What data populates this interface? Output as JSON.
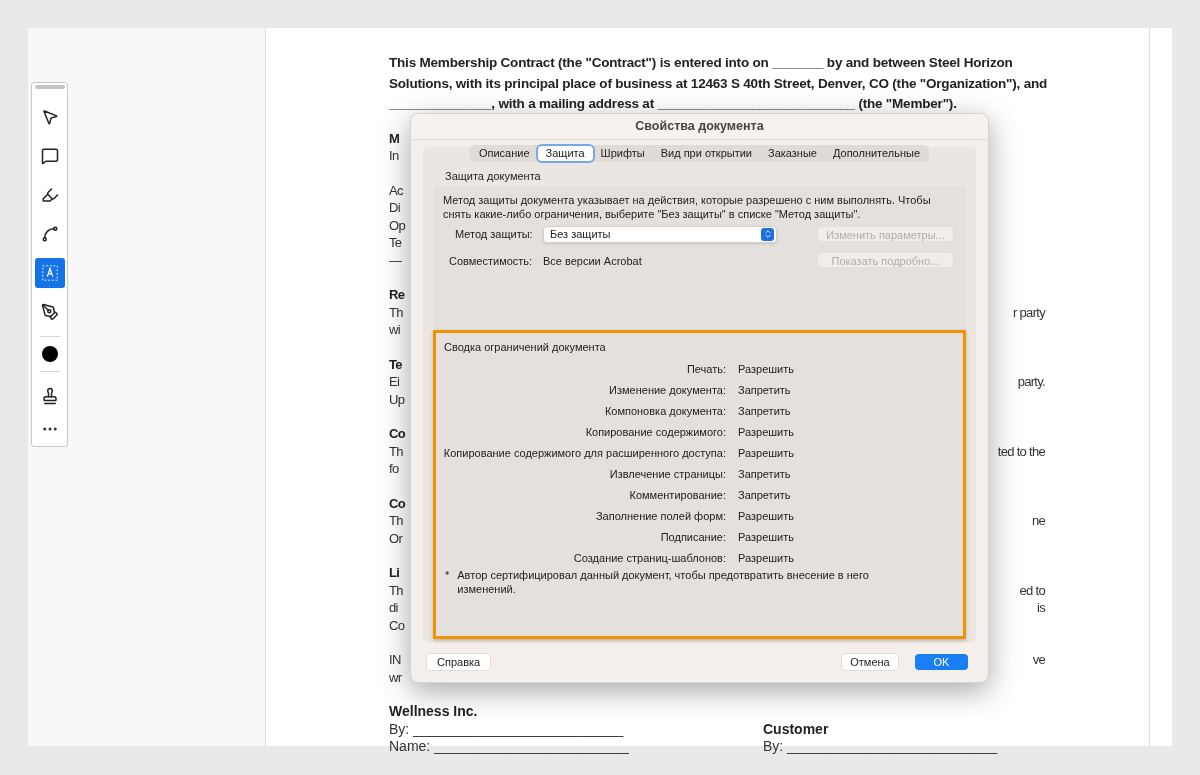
{
  "toolbar": {
    "tools": [
      {
        "kind": "pointer",
        "selected": false
      },
      {
        "kind": "comment",
        "selected": false
      },
      {
        "kind": "highlight",
        "selected": false
      },
      {
        "kind": "draw",
        "selected": false
      },
      {
        "kind": "text-box",
        "selected": true
      },
      {
        "kind": "sign",
        "selected": false
      },
      {
        "kind": "separator"
      },
      {
        "kind": "color",
        "color": "#000000"
      },
      {
        "kind": "separator"
      },
      {
        "kind": "stamp",
        "selected": false
      },
      {
        "kind": "more"
      }
    ]
  },
  "document": {
    "intro": "This Membership Contract (the \"Contract\") is entered into on _______ by and between Steel Horizon Solutions, with its principal place of business at 12463 S 40th Street, Denver, CO (the \"Organization\"), and ______________, with a mailing address at ___________________________ (the \"Member\").",
    "sections": [
      {
        "heading": "M",
        "lines": [
          {
            "left": "In"
          }
        ]
      },
      {
        "lines": [
          {
            "left": "Ac"
          },
          {
            "left": "Di"
          },
          {
            "left": "Op"
          },
          {
            "left": "Te"
          },
          {
            "left": "—"
          }
        ]
      },
      {
        "heading": "Re",
        "lines": [
          {
            "left": "Th",
            "right": "r party"
          },
          {
            "left": "wi"
          }
        ]
      },
      {
        "heading": "Te",
        "lines": [
          {
            "left": "Ei",
            "right": "party."
          },
          {
            "left": "Up"
          }
        ]
      },
      {
        "heading": "Co",
        "lines": [
          {
            "left": "Th",
            "right": "ted to the"
          },
          {
            "left": "fo"
          }
        ]
      },
      {
        "heading": "Co",
        "lines": [
          {
            "left": "Th",
            "right": "ne"
          },
          {
            "left": "Or"
          }
        ]
      },
      {
        "heading": "Li",
        "lines": [
          {
            "left": "Th",
            "right": "ed to"
          },
          {
            "left": "di",
            "right": "is"
          },
          {
            "left": "Co"
          }
        ]
      },
      {
        "lines": [
          {
            "left": "IN",
            "right": "ve"
          },
          {
            "left": "wr"
          }
        ]
      }
    ],
    "signatures": [
      {
        "party": "Wellness Inc.",
        "lines": [
          "By: ___________________________",
          "Name: _________________________"
        ]
      },
      {
        "party": "Customer",
        "lines": [
          "By: ___________________________"
        ]
      }
    ]
  },
  "dialog": {
    "title": "Свойства документа",
    "tabs": [
      {
        "label": "Описание",
        "selected": false
      },
      {
        "label": "Защита",
        "selected": true
      },
      {
        "label": "Шрифты",
        "selected": false
      },
      {
        "label": "Вид при открытии",
        "selected": false
      },
      {
        "label": "Заказные",
        "selected": false
      },
      {
        "label": "Дополнительные",
        "selected": false
      }
    ],
    "security": {
      "title": "Защита документа",
      "description": "Метод защиты документа указывает на действия, которые разрешено с ним выполнять. Чтобы снять какие-либо ограничения, выберите \"Без защиты\" в списке \"Метод защиты\".",
      "method_label": "Метод защиты:",
      "method_value": "Без защиты",
      "change_button": {
        "label": "Изменить параметры...",
        "disabled": true
      },
      "compat_label": "Совместимость:",
      "compat_value": "Все версии Acrobat",
      "details_button": {
        "label": "Показать подробно...",
        "disabled": true
      }
    },
    "summary": {
      "title": "Сводка ограничений документа",
      "highlighted": true,
      "rows": [
        {
          "label": "Печать:",
          "value": "Разрешить"
        },
        {
          "label": "Изменение документа:",
          "value": "Запретить"
        },
        {
          "label": "Компоновка документа:",
          "value": "Запретить"
        },
        {
          "label": "Копирование содержимого:",
          "value": "Разрешить"
        },
        {
          "label": "Копирование содержимого для расширенного доступа:",
          "value": "Разрешить"
        },
        {
          "label": "Извлечение страницы:",
          "value": "Запретить"
        },
        {
          "label": "Комментирование:",
          "value": "Запретить"
        },
        {
          "label": "Заполнение полей форм:",
          "value": "Разрешить"
        },
        {
          "label": "Подписание:",
          "value": "Разрешить"
        },
        {
          "label": "Создание страниц-шаблонов:",
          "value": "Разрешить"
        }
      ],
      "note_mark": "*",
      "note": "Автор сертифицировал данный документ, чтобы предотвратить внесение в него изменений."
    },
    "help_button": "Справка",
    "cancel_button": "Отмена",
    "ok_button": "OK"
  }
}
